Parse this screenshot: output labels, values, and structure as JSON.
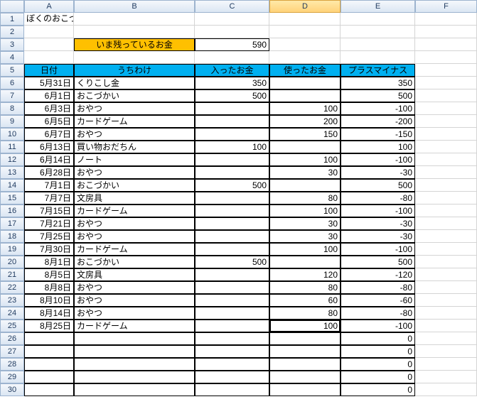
{
  "columns": [
    "A",
    "B",
    "C",
    "D",
    "E",
    "F"
  ],
  "rowCount": 30,
  "selectedCol": 3,
  "selectedRow": 25,
  "title": "ぼくのおこづかい帳",
  "balance": {
    "label": "いま残っているお金",
    "value": "590"
  },
  "headers": {
    "date": "日付",
    "desc": "うちわけ",
    "in": "入ったお金",
    "out": "使ったお金",
    "pm": "プラスマイナス"
  },
  "rows": [
    {
      "date": "5月31日",
      "desc": "くりこし金",
      "in": "350",
      "out": "",
      "pm": "350"
    },
    {
      "date": "6月1日",
      "desc": "おこづかい",
      "in": "500",
      "out": "",
      "pm": "500"
    },
    {
      "date": "6月3日",
      "desc": "おやつ",
      "in": "",
      "out": "100",
      "pm": "-100"
    },
    {
      "date": "6月5日",
      "desc": "カードゲーム",
      "in": "",
      "out": "200",
      "pm": "-200"
    },
    {
      "date": "6月7日",
      "desc": "おやつ",
      "in": "",
      "out": "150",
      "pm": "-150"
    },
    {
      "date": "6月13日",
      "desc": "買い物おだちん",
      "in": "100",
      "out": "",
      "pm": "100"
    },
    {
      "date": "6月14日",
      "desc": "ノート",
      "in": "",
      "out": "100",
      "pm": "-100"
    },
    {
      "date": "6月28日",
      "desc": "おやつ",
      "in": "",
      "out": "30",
      "pm": "-30"
    },
    {
      "date": "7月1日",
      "desc": "おこづかい",
      "in": "500",
      "out": "",
      "pm": "500"
    },
    {
      "date": "7月7日",
      "desc": "文房具",
      "in": "",
      "out": "80",
      "pm": "-80"
    },
    {
      "date": "7月15日",
      "desc": "カードゲーム",
      "in": "",
      "out": "100",
      "pm": "-100"
    },
    {
      "date": "7月21日",
      "desc": "おやつ",
      "in": "",
      "out": "30",
      "pm": "-30"
    },
    {
      "date": "7月25日",
      "desc": "おやつ",
      "in": "",
      "out": "30",
      "pm": "-30"
    },
    {
      "date": "7月30日",
      "desc": "カードゲーム",
      "in": "",
      "out": "100",
      "pm": "-100"
    },
    {
      "date": "8月1日",
      "desc": "おこづかい",
      "in": "500",
      "out": "",
      "pm": "500"
    },
    {
      "date": "8月5日",
      "desc": "文房具",
      "in": "",
      "out": "120",
      "pm": "-120"
    },
    {
      "date": "8月8日",
      "desc": "おやつ",
      "in": "",
      "out": "80",
      "pm": "-80"
    },
    {
      "date": "8月10日",
      "desc": "おやつ",
      "in": "",
      "out": "60",
      "pm": "-60"
    },
    {
      "date": "8月14日",
      "desc": "おやつ",
      "in": "",
      "out": "80",
      "pm": "-80"
    },
    {
      "date": "8月25日",
      "desc": "カードゲーム",
      "in": "",
      "out": "100",
      "pm": "-100"
    },
    {
      "date": "",
      "desc": "",
      "in": "",
      "out": "",
      "pm": "0"
    },
    {
      "date": "",
      "desc": "",
      "in": "",
      "out": "",
      "pm": "0"
    },
    {
      "date": "",
      "desc": "",
      "in": "",
      "out": "",
      "pm": "0"
    },
    {
      "date": "",
      "desc": "",
      "in": "",
      "out": "",
      "pm": "0"
    },
    {
      "date": "",
      "desc": "",
      "in": "",
      "out": "",
      "pm": "0"
    }
  ]
}
